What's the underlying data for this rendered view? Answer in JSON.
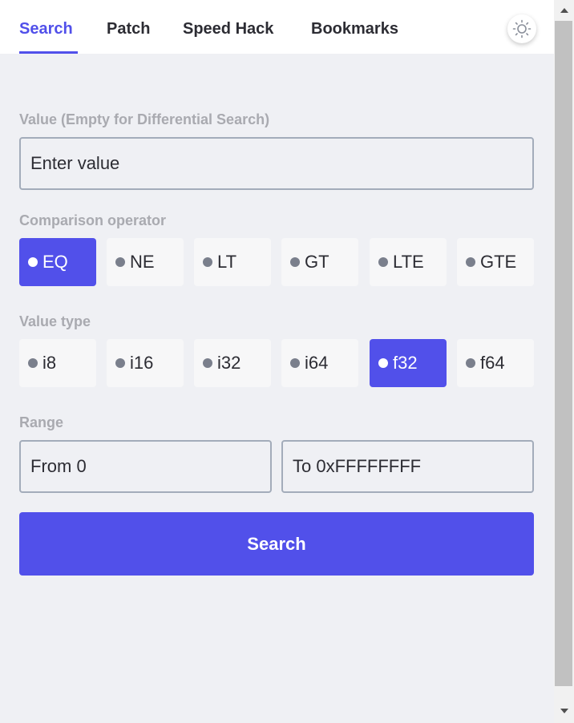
{
  "tabs": [
    {
      "label": "Search",
      "active": true
    },
    {
      "label": "Patch",
      "active": false
    },
    {
      "label": "Speed Hack",
      "active": false
    },
    {
      "label": "Bookmarks",
      "active": false
    }
  ],
  "theme_toggle_icon": "sun-icon",
  "value_field": {
    "label": "Value (Empty for Differential Search)",
    "placeholder": "Enter value",
    "value": ""
  },
  "comparison": {
    "label": "Comparison operator",
    "options": [
      "EQ",
      "NE",
      "LT",
      "GT",
      "LTE",
      "GTE"
    ],
    "selected": "EQ"
  },
  "value_type": {
    "label": "Value type",
    "options": [
      "i8",
      "i16",
      "i32",
      "i64",
      "f32",
      "f64"
    ],
    "selected": "f32"
  },
  "range": {
    "label": "Range",
    "from_placeholder": "From 0",
    "to_placeholder": "To 0xFFFFFFFF"
  },
  "search_button_label": "Search",
  "colors": {
    "accent": "#5150ea",
    "background": "#eff0f4",
    "header_bg": "#ffffff",
    "label_text": "#a9aab0",
    "body_text": "#2c2c33",
    "input_border": "#a3acba",
    "option_bg": "#f7f7f8"
  }
}
